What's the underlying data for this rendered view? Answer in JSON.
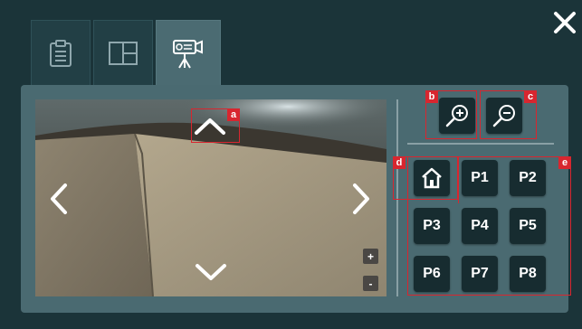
{
  "colors": {
    "background": "#1b3439",
    "panel": "#4a6a71",
    "button": "#172c30",
    "annotation": "#d8262f",
    "active_tab": "#4b6b72"
  },
  "tabs": [
    {
      "icon": "clipboard-icon",
      "active": false
    },
    {
      "icon": "layout-grid-icon",
      "active": false
    },
    {
      "icon": "video-camera-icon",
      "active": true
    }
  ],
  "close_icon": "close-icon",
  "camera": {
    "icons": {
      "up": "chevron-up-icon",
      "down": "chevron-down-icon",
      "left": "chevron-left-icon",
      "right": "chevron-right-icon"
    },
    "zoom_plus": "+",
    "zoom_minus": "-"
  },
  "controls": {
    "zoom_in_icon": "zoom-in-icon",
    "zoom_out_icon": "zoom-out-icon",
    "home_icon": "home-icon",
    "presets": [
      "P1",
      "P2",
      "P3",
      "P4",
      "P5",
      "P6",
      "P7",
      "P8"
    ]
  },
  "annotations": {
    "a": "a",
    "b": "b",
    "c": "c",
    "d": "d",
    "e": "e"
  }
}
